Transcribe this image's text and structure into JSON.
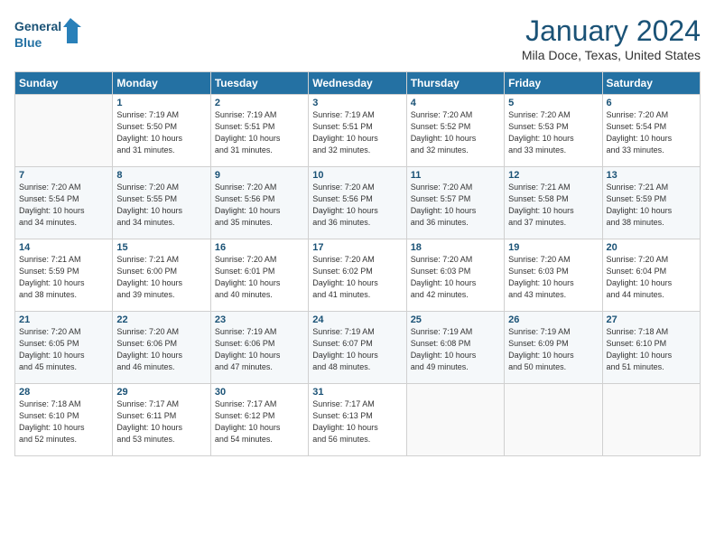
{
  "header": {
    "logo_line1": "General",
    "logo_line2": "Blue",
    "title": "January 2024",
    "location": "Mila Doce, Texas, United States"
  },
  "days_of_week": [
    "Sunday",
    "Monday",
    "Tuesday",
    "Wednesday",
    "Thursday",
    "Friday",
    "Saturday"
  ],
  "weeks": [
    [
      {
        "day": "",
        "info": ""
      },
      {
        "day": "1",
        "info": "Sunrise: 7:19 AM\nSunset: 5:50 PM\nDaylight: 10 hours\nand 31 minutes."
      },
      {
        "day": "2",
        "info": "Sunrise: 7:19 AM\nSunset: 5:51 PM\nDaylight: 10 hours\nand 31 minutes."
      },
      {
        "day": "3",
        "info": "Sunrise: 7:19 AM\nSunset: 5:51 PM\nDaylight: 10 hours\nand 32 minutes."
      },
      {
        "day": "4",
        "info": "Sunrise: 7:20 AM\nSunset: 5:52 PM\nDaylight: 10 hours\nand 32 minutes."
      },
      {
        "day": "5",
        "info": "Sunrise: 7:20 AM\nSunset: 5:53 PM\nDaylight: 10 hours\nand 33 minutes."
      },
      {
        "day": "6",
        "info": "Sunrise: 7:20 AM\nSunset: 5:54 PM\nDaylight: 10 hours\nand 33 minutes."
      }
    ],
    [
      {
        "day": "7",
        "info": "Sunrise: 7:20 AM\nSunset: 5:54 PM\nDaylight: 10 hours\nand 34 minutes."
      },
      {
        "day": "8",
        "info": "Sunrise: 7:20 AM\nSunset: 5:55 PM\nDaylight: 10 hours\nand 34 minutes."
      },
      {
        "day": "9",
        "info": "Sunrise: 7:20 AM\nSunset: 5:56 PM\nDaylight: 10 hours\nand 35 minutes."
      },
      {
        "day": "10",
        "info": "Sunrise: 7:20 AM\nSunset: 5:56 PM\nDaylight: 10 hours\nand 36 minutes."
      },
      {
        "day": "11",
        "info": "Sunrise: 7:20 AM\nSunset: 5:57 PM\nDaylight: 10 hours\nand 36 minutes."
      },
      {
        "day": "12",
        "info": "Sunrise: 7:21 AM\nSunset: 5:58 PM\nDaylight: 10 hours\nand 37 minutes."
      },
      {
        "day": "13",
        "info": "Sunrise: 7:21 AM\nSunset: 5:59 PM\nDaylight: 10 hours\nand 38 minutes."
      }
    ],
    [
      {
        "day": "14",
        "info": "Sunrise: 7:21 AM\nSunset: 5:59 PM\nDaylight: 10 hours\nand 38 minutes."
      },
      {
        "day": "15",
        "info": "Sunrise: 7:21 AM\nSunset: 6:00 PM\nDaylight: 10 hours\nand 39 minutes."
      },
      {
        "day": "16",
        "info": "Sunrise: 7:20 AM\nSunset: 6:01 PM\nDaylight: 10 hours\nand 40 minutes."
      },
      {
        "day": "17",
        "info": "Sunrise: 7:20 AM\nSunset: 6:02 PM\nDaylight: 10 hours\nand 41 minutes."
      },
      {
        "day": "18",
        "info": "Sunrise: 7:20 AM\nSunset: 6:03 PM\nDaylight: 10 hours\nand 42 minutes."
      },
      {
        "day": "19",
        "info": "Sunrise: 7:20 AM\nSunset: 6:03 PM\nDaylight: 10 hours\nand 43 minutes."
      },
      {
        "day": "20",
        "info": "Sunrise: 7:20 AM\nSunset: 6:04 PM\nDaylight: 10 hours\nand 44 minutes."
      }
    ],
    [
      {
        "day": "21",
        "info": "Sunrise: 7:20 AM\nSunset: 6:05 PM\nDaylight: 10 hours\nand 45 minutes."
      },
      {
        "day": "22",
        "info": "Sunrise: 7:20 AM\nSunset: 6:06 PM\nDaylight: 10 hours\nand 46 minutes."
      },
      {
        "day": "23",
        "info": "Sunrise: 7:19 AM\nSunset: 6:06 PM\nDaylight: 10 hours\nand 47 minutes."
      },
      {
        "day": "24",
        "info": "Sunrise: 7:19 AM\nSunset: 6:07 PM\nDaylight: 10 hours\nand 48 minutes."
      },
      {
        "day": "25",
        "info": "Sunrise: 7:19 AM\nSunset: 6:08 PM\nDaylight: 10 hours\nand 49 minutes."
      },
      {
        "day": "26",
        "info": "Sunrise: 7:19 AM\nSunset: 6:09 PM\nDaylight: 10 hours\nand 50 minutes."
      },
      {
        "day": "27",
        "info": "Sunrise: 7:18 AM\nSunset: 6:10 PM\nDaylight: 10 hours\nand 51 minutes."
      }
    ],
    [
      {
        "day": "28",
        "info": "Sunrise: 7:18 AM\nSunset: 6:10 PM\nDaylight: 10 hours\nand 52 minutes."
      },
      {
        "day": "29",
        "info": "Sunrise: 7:17 AM\nSunset: 6:11 PM\nDaylight: 10 hours\nand 53 minutes."
      },
      {
        "day": "30",
        "info": "Sunrise: 7:17 AM\nSunset: 6:12 PM\nDaylight: 10 hours\nand 54 minutes."
      },
      {
        "day": "31",
        "info": "Sunrise: 7:17 AM\nSunset: 6:13 PM\nDaylight: 10 hours\nand 56 minutes."
      },
      {
        "day": "",
        "info": ""
      },
      {
        "day": "",
        "info": ""
      },
      {
        "day": "",
        "info": ""
      }
    ]
  ]
}
